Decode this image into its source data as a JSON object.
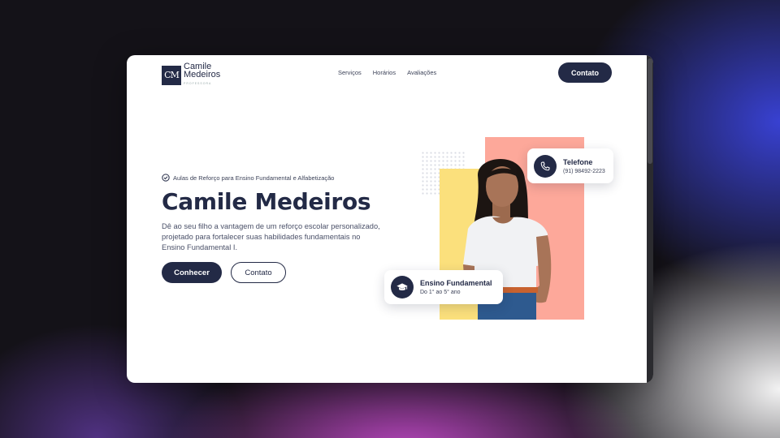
{
  "colors": {
    "brand": "#232a46",
    "accent_yellow": "#fbe07c",
    "accent_coral": "#fda89a"
  },
  "header": {
    "logo_mark": "CM",
    "logo_name_line1": "Camile",
    "logo_name_line2": "Medeiros",
    "logo_subtitle": "PROFESSORA",
    "nav": [
      {
        "label": "Serviços"
      },
      {
        "label": "Horários"
      },
      {
        "label": "Avaliações"
      }
    ],
    "contact_label": "Contato"
  },
  "hero": {
    "tagline": "Aulas de Reforço para Ensino Fundamental e Alfabetização",
    "title": "Camile Medeiros",
    "description": "Dê ao seu filho a vantagem de um reforço escolar personalizado, projetado para fortalecer suas habilidades fundamentais no Ensino Fundamental I.",
    "primary_button": "Conhecer",
    "secondary_button": "Contato"
  },
  "cards": {
    "phone": {
      "title": "Telefone",
      "value": "(91) 98492-2223",
      "icon": "phone-icon"
    },
    "education": {
      "title": "Ensino Fundamental",
      "value": "Do 1° ao 5° ano",
      "icon": "graduation-cap-icon"
    }
  }
}
